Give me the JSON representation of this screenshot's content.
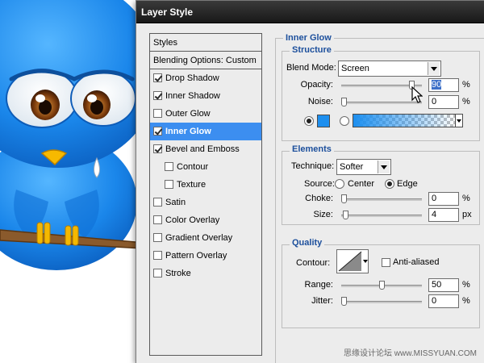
{
  "window": {
    "title": "Layer Style"
  },
  "styles_list": {
    "items": [
      {
        "label": "Styles",
        "type": "header"
      },
      {
        "label": "Blending Options: Custom",
        "type": "header"
      },
      {
        "label": "Drop Shadow",
        "checked": true
      },
      {
        "label": "Inner Shadow",
        "checked": true
      },
      {
        "label": "Outer Glow",
        "checked": false
      },
      {
        "label": "Inner Glow",
        "checked": true,
        "selected": true
      },
      {
        "label": "Bevel and Emboss",
        "checked": true
      },
      {
        "label": "Contour",
        "checked": false,
        "indent": true
      },
      {
        "label": "Texture",
        "checked": false,
        "indent": true
      },
      {
        "label": "Satin",
        "checked": false
      },
      {
        "label": "Color Overlay",
        "checked": false
      },
      {
        "label": "Gradient Overlay",
        "checked": false
      },
      {
        "label": "Pattern Overlay",
        "checked": false
      },
      {
        "label": "Stroke",
        "checked": false
      }
    ]
  },
  "inner_glow": {
    "title": "Inner Glow",
    "structure": {
      "title": "Structure",
      "blend_mode_label": "Blend Mode:",
      "blend_mode_value": "Screen",
      "opacity_label": "Opacity:",
      "opacity_value": "90",
      "opacity_level": 0.9,
      "opacity_unit": "%",
      "noise_label": "Noise:",
      "noise_value": "0",
      "noise_level": 0,
      "noise_unit": "%",
      "glow_color": "#1d8fef"
    },
    "elements": {
      "title": "Elements",
      "technique_label": "Technique:",
      "technique_value": "Softer",
      "source_label": "Source:",
      "source_center": "Center",
      "source_edge": "Edge",
      "choke_label": "Choke:",
      "choke_value": "0",
      "choke_level": 0,
      "choke_unit": "%",
      "size_label": "Size:",
      "size_value": "4",
      "size_level": 0.02,
      "size_unit": "px"
    },
    "quality": {
      "title": "Quality",
      "contour_label": "Contour:",
      "anti_aliased_label": "Anti-aliased",
      "range_label": "Range:",
      "range_value": "50",
      "range_level": 0.5,
      "range_unit": "%",
      "jitter_label": "Jitter:",
      "jitter_value": "0",
      "jitter_level": 0,
      "jitter_unit": "%"
    }
  },
  "watermark": "思缘设计论坛 www.MISSYUAN.COM"
}
